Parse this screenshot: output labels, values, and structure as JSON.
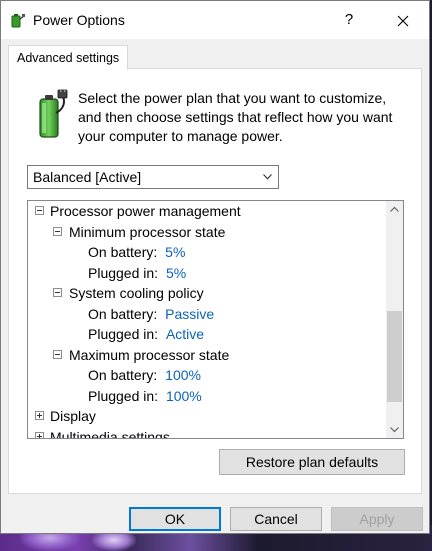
{
  "window": {
    "title": "Power Options",
    "help_glyph": "?",
    "icons": {
      "app": "power-options-icon",
      "help": "help-icon",
      "close": "close-icon"
    }
  },
  "tab": {
    "label": "Advanced settings"
  },
  "intro": {
    "icon": "battery-plug-icon",
    "text": "Select the power plan that you want to customize, and then choose settings that reflect how you want your computer to manage power."
  },
  "plan_select": {
    "value": "Balanced [Active]"
  },
  "tree": {
    "processor": {
      "label": "Processor power management",
      "min_state": {
        "label": "Minimum processor state",
        "on_battery_label": "On battery:",
        "on_battery_value": "5%",
        "plugged_in_label": "Plugged in:",
        "plugged_in_value": "5%"
      },
      "cooling": {
        "label": "System cooling policy",
        "on_battery_label": "On battery:",
        "on_battery_value": "Passive",
        "plugged_in_label": "Plugged in:",
        "plugged_in_value": "Active"
      },
      "max_state": {
        "label": "Maximum processor state",
        "on_battery_label": "On battery:",
        "on_battery_value": "100%",
        "plugged_in_label": "Plugged in:",
        "plugged_in_value": "100%"
      }
    },
    "display": {
      "label": "Display"
    },
    "multimedia": {
      "label": "Multimedia settings"
    }
  },
  "buttons": {
    "restore": "Restore plan defaults",
    "ok": "OK",
    "cancel": "Cancel",
    "apply": "Apply"
  },
  "colors": {
    "value_link": "#0b62b8",
    "focus_border": "#0078d7"
  }
}
